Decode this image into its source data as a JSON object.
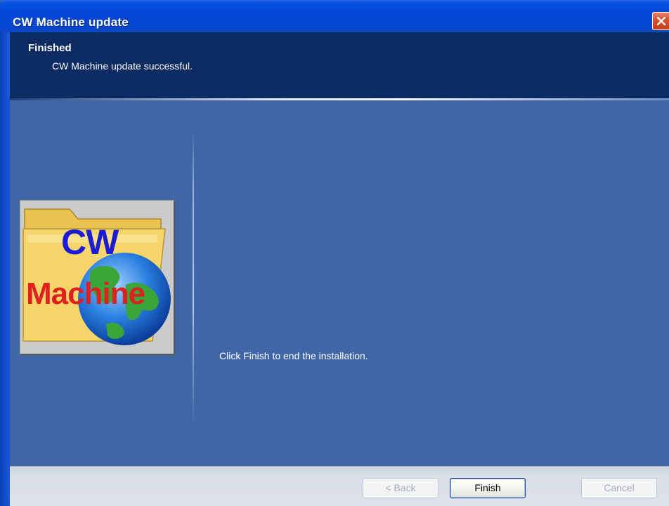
{
  "window": {
    "title": "CW Machine update"
  },
  "header": {
    "heading": "Finished",
    "subheading": "CW Machine update successful."
  },
  "logo": {
    "line1": "CW",
    "line2": "Machine"
  },
  "body": {
    "message": "Click Finish to end the installation."
  },
  "buttons": {
    "back": "< Back",
    "finish": "Finish",
    "cancel": "Cancel"
  },
  "icons": {
    "close": "close-icon",
    "folder": "folder-icon",
    "globe": "globe-icon"
  },
  "colors": {
    "titlebar": "#0245d6",
    "header_bg": "#0c2b63",
    "body_bg": "#4066a8",
    "logo_cw": "#1c1cd6",
    "logo_machine": "#e02020",
    "close_button": "#d9532e"
  }
}
